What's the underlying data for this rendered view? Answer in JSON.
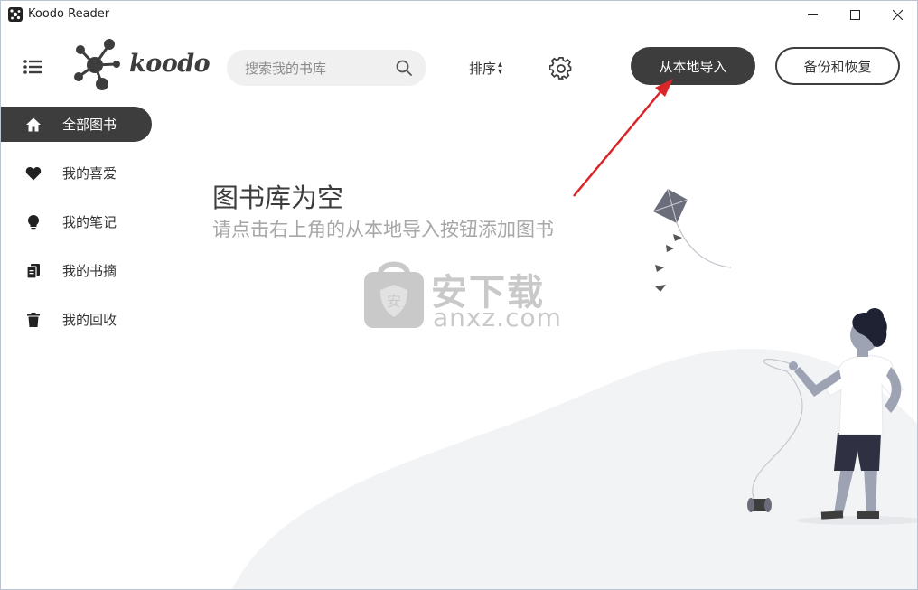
{
  "window": {
    "title": "Koodo Reader"
  },
  "header": {
    "logo_text": "koodo",
    "search_placeholder": "搜索我的书库",
    "sort_label": "排序",
    "import_label": "从本地导入",
    "backup_label": "备份和恢复"
  },
  "sidebar": {
    "items": [
      {
        "label": "全部图书",
        "icon": "home-icon",
        "active": true
      },
      {
        "label": "我的喜爱",
        "icon": "heart-icon",
        "active": false
      },
      {
        "label": "我的笔记",
        "icon": "bulb-icon",
        "active": false
      },
      {
        "label": "我的书摘",
        "icon": "copy-icon",
        "active": false
      },
      {
        "label": "我的回收",
        "icon": "trash-icon",
        "active": false
      }
    ]
  },
  "empty_state": {
    "title": "图书库为空",
    "subtitle": "请点击右上角的从本地导入按钮添加图书"
  },
  "watermark": {
    "text_cn": "安下载",
    "text_en": "anxz.com"
  },
  "colors": {
    "accent_dark": "#3d3d3d",
    "arrow_red": "#d9262a",
    "muted_text": "#a7a7a7"
  }
}
